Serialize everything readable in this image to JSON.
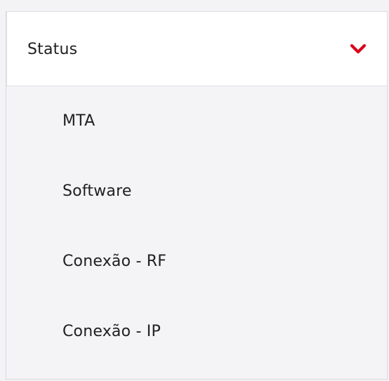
{
  "accordion": {
    "title": "Status",
    "expanded": true,
    "chevron_icon": "chevron-down-icon",
    "accent_color": "#d9001a",
    "items": [
      {
        "label": "MTA"
      },
      {
        "label": "Software"
      },
      {
        "label": "Conexão - RF"
      },
      {
        "label": "Conexão - IP"
      }
    ]
  }
}
